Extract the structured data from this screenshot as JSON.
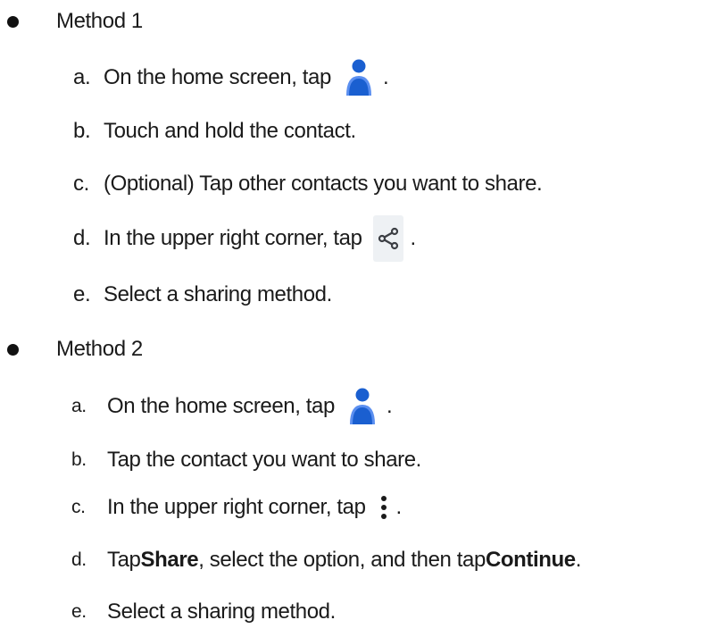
{
  "method1": {
    "title": "Method 1",
    "steps": [
      {
        "marker": "a.",
        "text": "On the home screen, tap",
        "icon": "contacts-person-icon",
        "end": "."
      },
      {
        "marker": "b.",
        "text": "Touch and hold the contact."
      },
      {
        "marker": "c.",
        "text": "(Optional) Tap other contacts you want to share."
      },
      {
        "marker": "d.",
        "text": "In the upper right corner, tap",
        "icon": "share-icon",
        "end": "."
      },
      {
        "marker": "e.",
        "text": "Select a sharing method."
      }
    ]
  },
  "method2": {
    "title": "Method 2",
    "steps": [
      {
        "marker": "a.",
        "text": "On the home screen, tap",
        "icon": "contacts-person-icon",
        "end": "."
      },
      {
        "marker": "b.",
        "text": "Tap the contact you want to share."
      },
      {
        "marker": "c.",
        "text": "In the upper right corner, tap",
        "icon": "more-vertical-icon",
        "end": "."
      },
      {
        "marker": "d.",
        "parts": [
          "Tap ",
          "Share",
          ", select the option, and then tap ",
          "Continue",
          "."
        ]
      },
      {
        "marker": "e.",
        "text": "Select a sharing method."
      }
    ]
  },
  "colors": {
    "icon_blue_dark": "#1a5fd0",
    "icon_blue_light": "#5b8ff0",
    "share_icon_bg": "#eef1f4",
    "text": "#1a1a1a"
  }
}
